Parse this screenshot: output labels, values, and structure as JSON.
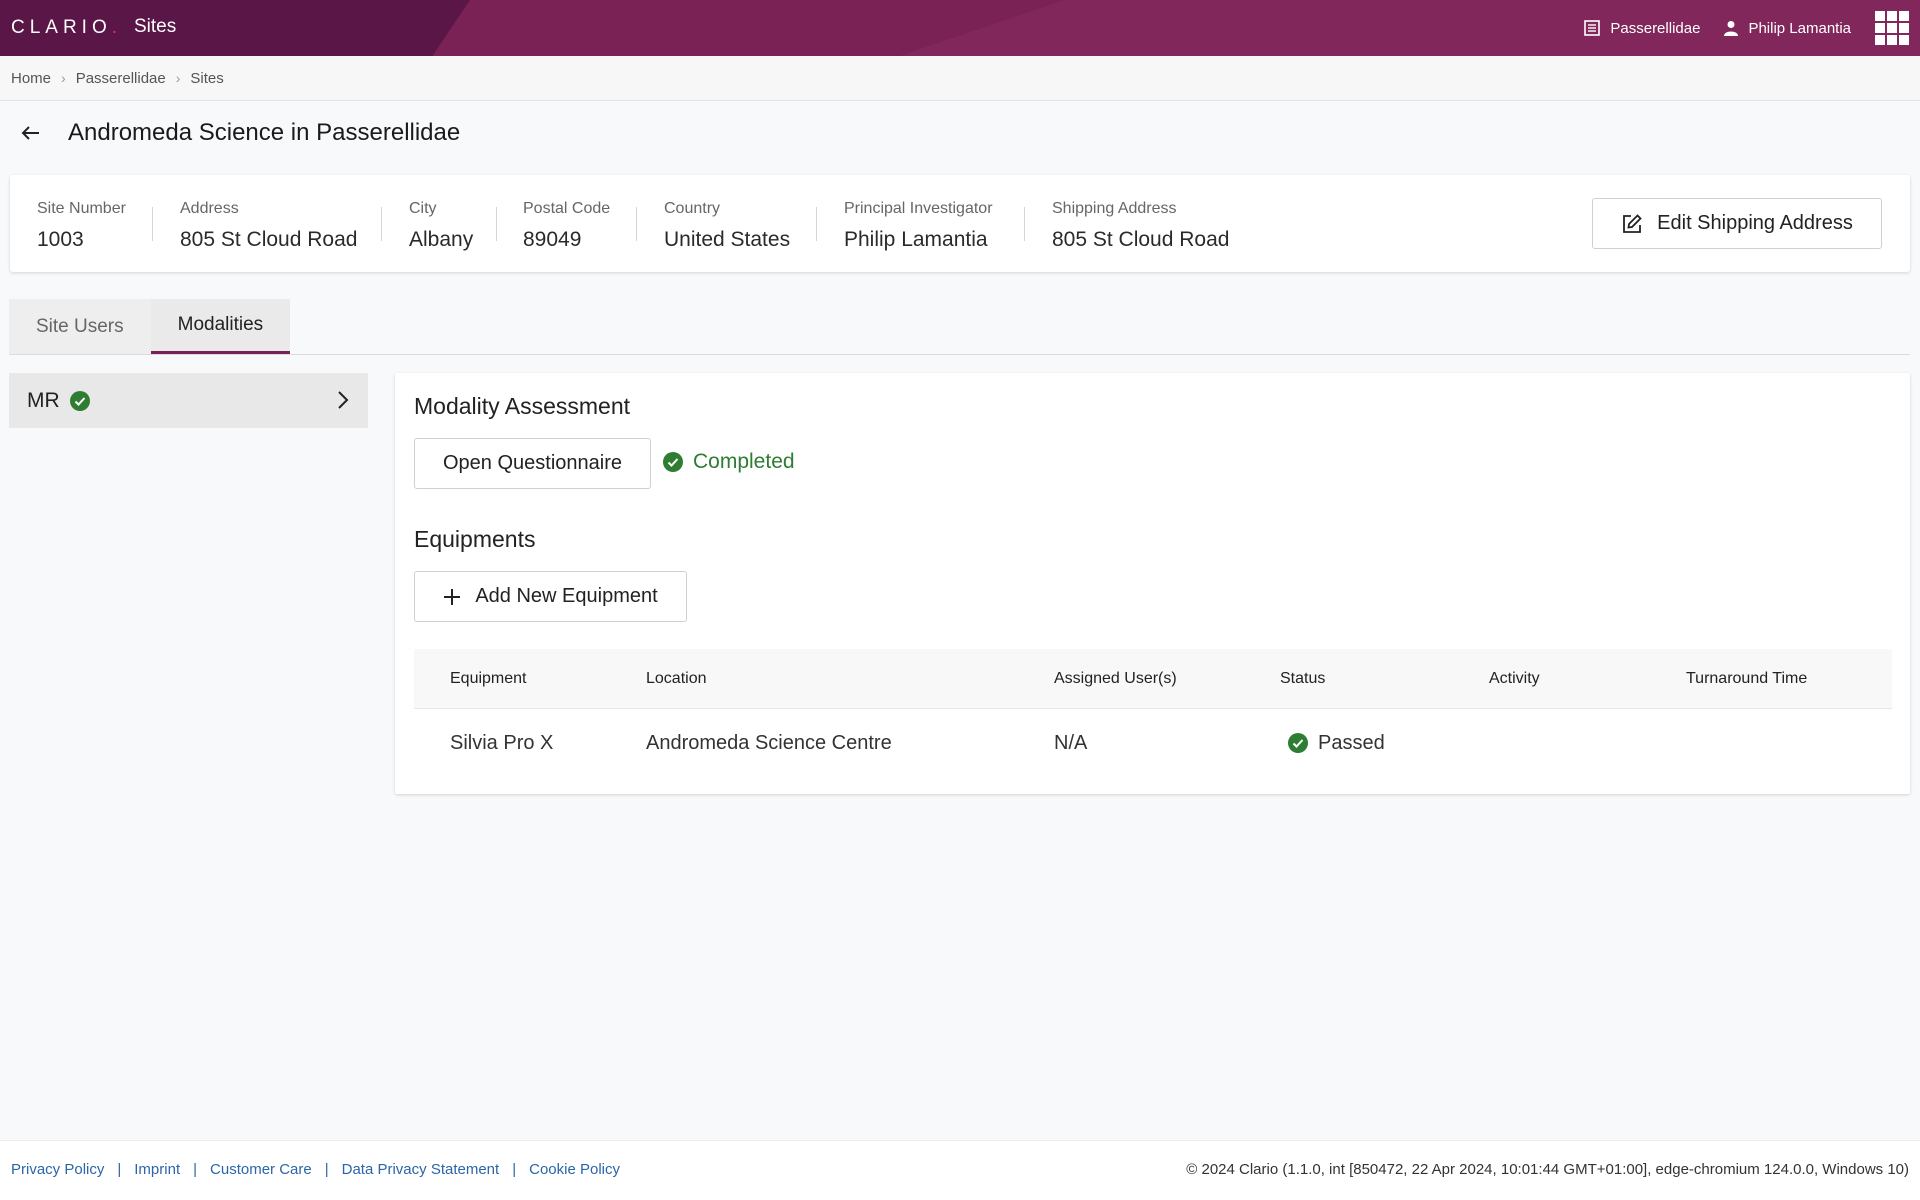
{
  "header": {
    "logo_text": "CLARIO",
    "logo_dot": ".",
    "app_title": "Sites",
    "study": "Passerellidae",
    "user": "Philip Lamantia"
  },
  "breadcrumb": [
    "Home",
    "Passerellidae",
    "Sites"
  ],
  "page": {
    "title": "Andromeda Science in Passerellidae"
  },
  "site_info": {
    "fields": [
      {
        "label": "Site Number",
        "value": "1003"
      },
      {
        "label": "Address",
        "value": "805 St Cloud Road"
      },
      {
        "label": "City",
        "value": "Albany"
      },
      {
        "label": "Postal Code",
        "value": "89049"
      },
      {
        "label": "Country",
        "value": "United States"
      },
      {
        "label": "Principal Investigator",
        "value": "Philip Lamantia"
      },
      {
        "label": "Shipping Address",
        "value": "805 St Cloud Road"
      }
    ],
    "edit_button": "Edit Shipping Address"
  },
  "tabs": [
    {
      "label": "Site Users",
      "active": false
    },
    {
      "label": "Modalities",
      "active": true
    }
  ],
  "modalities": [
    {
      "label": "MR",
      "status": "completed"
    }
  ],
  "modality_assessment": {
    "title": "Modality Assessment",
    "open_button": "Open Questionnaire",
    "status": "Completed"
  },
  "equipments": {
    "title": "Equipments",
    "add_button": "Add New Equipment",
    "columns": [
      "Equipment",
      "Location",
      "Assigned User(s)",
      "Status",
      "Activity",
      "Turnaround Time"
    ],
    "rows": [
      {
        "equipment": "Silvia Pro X",
        "location": "Andromeda Science Centre",
        "assigned": "N/A",
        "status": "Passed",
        "activity": "",
        "turnaround": ""
      }
    ]
  },
  "footer": {
    "links": [
      "Privacy Policy",
      "Imprint",
      "Customer Care",
      "Data Privacy Statement",
      "Cookie Policy"
    ],
    "separator": "|",
    "copyright": "© 2024 Clario (1.1.0, int [850472, 22 Apr 2024, 10:01:44 GMT+01:00], edge-chromium 124.0.0, Windows 10)"
  },
  "colors": {
    "brand": "#7a2256",
    "success": "#2e7d32",
    "link": "#2a66a8"
  }
}
